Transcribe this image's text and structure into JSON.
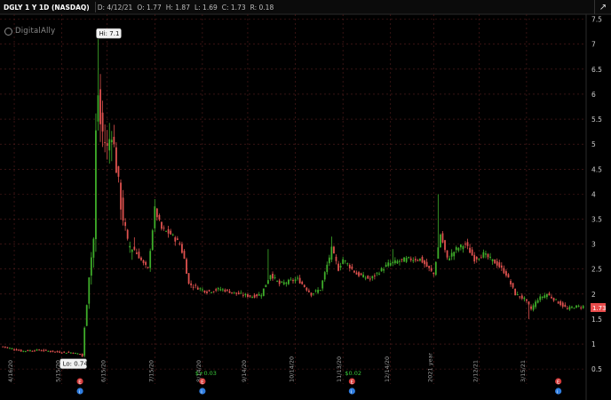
{
  "header": {
    "symbol": "DGLY 1 Y 1D (NASDAQ)",
    "date": "D: 4/12/21",
    "open": "O: 1.77",
    "high": "H: 1.87",
    "low": "L: 1.69",
    "close": "C: 1.73",
    "range": "R: 0.18"
  },
  "watermark": "DigitalAlly",
  "corner_icon": "expand-icon",
  "colors": {
    "up": "#3fae2a",
    "down": "#e0524f",
    "grid": "#5a1f1f",
    "axis_text": "#cfcfcf",
    "last_price_bg": "#e84b4b",
    "event_red": "#d43a3a",
    "event_blue": "#2f7de0",
    "dividend_text": "#38c93a"
  },
  "chart_data": {
    "type": "candlestick",
    "ylim": [
      0.2,
      7.6
    ],
    "y_ticks": [
      0.5,
      1,
      1.5,
      2,
      2.5,
      3,
      3.5,
      4,
      4.5,
      5,
      5.5,
      6,
      6.5,
      7,
      7.5
    ],
    "y_tick_labels": [
      "0.5",
      "1",
      "1.5",
      "2",
      "2.5",
      "3",
      "3.5",
      "4",
      "4.5",
      "5",
      "5.5",
      "6",
      "6.5",
      "7",
      "7.5"
    ],
    "x_tick_labels": [
      "4/16/20",
      "5/15/20",
      "6/15/20",
      "7/15/20",
      "8/14/20",
      "9/14/20",
      "10/14/20",
      "11/13/20",
      "12/14/20",
      "2021 year",
      "2/12/21",
      "3/15/21"
    ],
    "grid": true,
    "legend": "none",
    "annotations": {
      "high": "Hi: 7.1",
      "low": "Lo: 0.74"
    },
    "last_price": "1.73",
    "dividend_labels": [
      "$+0.03",
      "$0.02"
    ],
    "anchors": [
      [
        0,
        0.95
      ],
      [
        8,
        0.86
      ],
      [
        16,
        0.88
      ],
      [
        24,
        0.84
      ],
      [
        30,
        0.83
      ],
      [
        34,
        0.8
      ],
      [
        35,
        0.75
      ],
      [
        36,
        1.3
      ],
      [
        38,
        2.4
      ],
      [
        40,
        3.1
      ],
      [
        41,
        5.2
      ],
      [
        42,
        6.0
      ],
      [
        43,
        5.4
      ],
      [
        46,
        4.9
      ],
      [
        48,
        5.3
      ],
      [
        52,
        3.8
      ],
      [
        55,
        3.0
      ],
      [
        58,
        2.9
      ],
      [
        62,
        2.6
      ],
      [
        64,
        2.5
      ],
      [
        67,
        3.7
      ],
      [
        70,
        3.3
      ],
      [
        74,
        3.2
      ],
      [
        78,
        3.0
      ],
      [
        80,
        2.7
      ],
      [
        82,
        2.2
      ],
      [
        90,
        2.05
      ],
      [
        96,
        2.1
      ],
      [
        104,
        2.0
      ],
      [
        110,
        1.95
      ],
      [
        114,
        2.0
      ],
      [
        118,
        2.4
      ],
      [
        122,
        2.2
      ],
      [
        130,
        2.3
      ],
      [
        136,
        2.0
      ],
      [
        140,
        2.1
      ],
      [
        145,
        2.9
      ],
      [
        148,
        2.5
      ],
      [
        150,
        2.7
      ],
      [
        156,
        2.4
      ],
      [
        162,
        2.3
      ],
      [
        166,
        2.45
      ],
      [
        170,
        2.6
      ],
      [
        178,
        2.7
      ],
      [
        184,
        2.7
      ],
      [
        190,
        2.4
      ],
      [
        193,
        3.2
      ],
      [
        196,
        2.7
      ],
      [
        200,
        2.9
      ],
      [
        204,
        3.0
      ],
      [
        208,
        2.7
      ],
      [
        212,
        2.8
      ],
      [
        218,
        2.6
      ],
      [
        222,
        2.4
      ],
      [
        226,
        2.0
      ],
      [
        230,
        1.9
      ],
      [
        233,
        1.7
      ],
      [
        236,
        1.9
      ],
      [
        240,
        2.0
      ],
      [
        243,
        1.9
      ],
      [
        246,
        1.8
      ],
      [
        249,
        1.7
      ],
      [
        252,
        1.75
      ],
      [
        256,
        1.75
      ]
    ],
    "spikes": [
      {
        "i": 42,
        "high": 7.1
      },
      {
        "i": 35,
        "low": 0.74
      },
      {
        "i": 67,
        "high": 3.9
      },
      {
        "i": 117,
        "high": 2.9
      },
      {
        "i": 145,
        "high": 3.15
      },
      {
        "i": 172,
        "high": 2.9
      },
      {
        "i": 192,
        "high": 4.0
      },
      {
        "i": 232,
        "low": 1.5
      }
    ]
  }
}
